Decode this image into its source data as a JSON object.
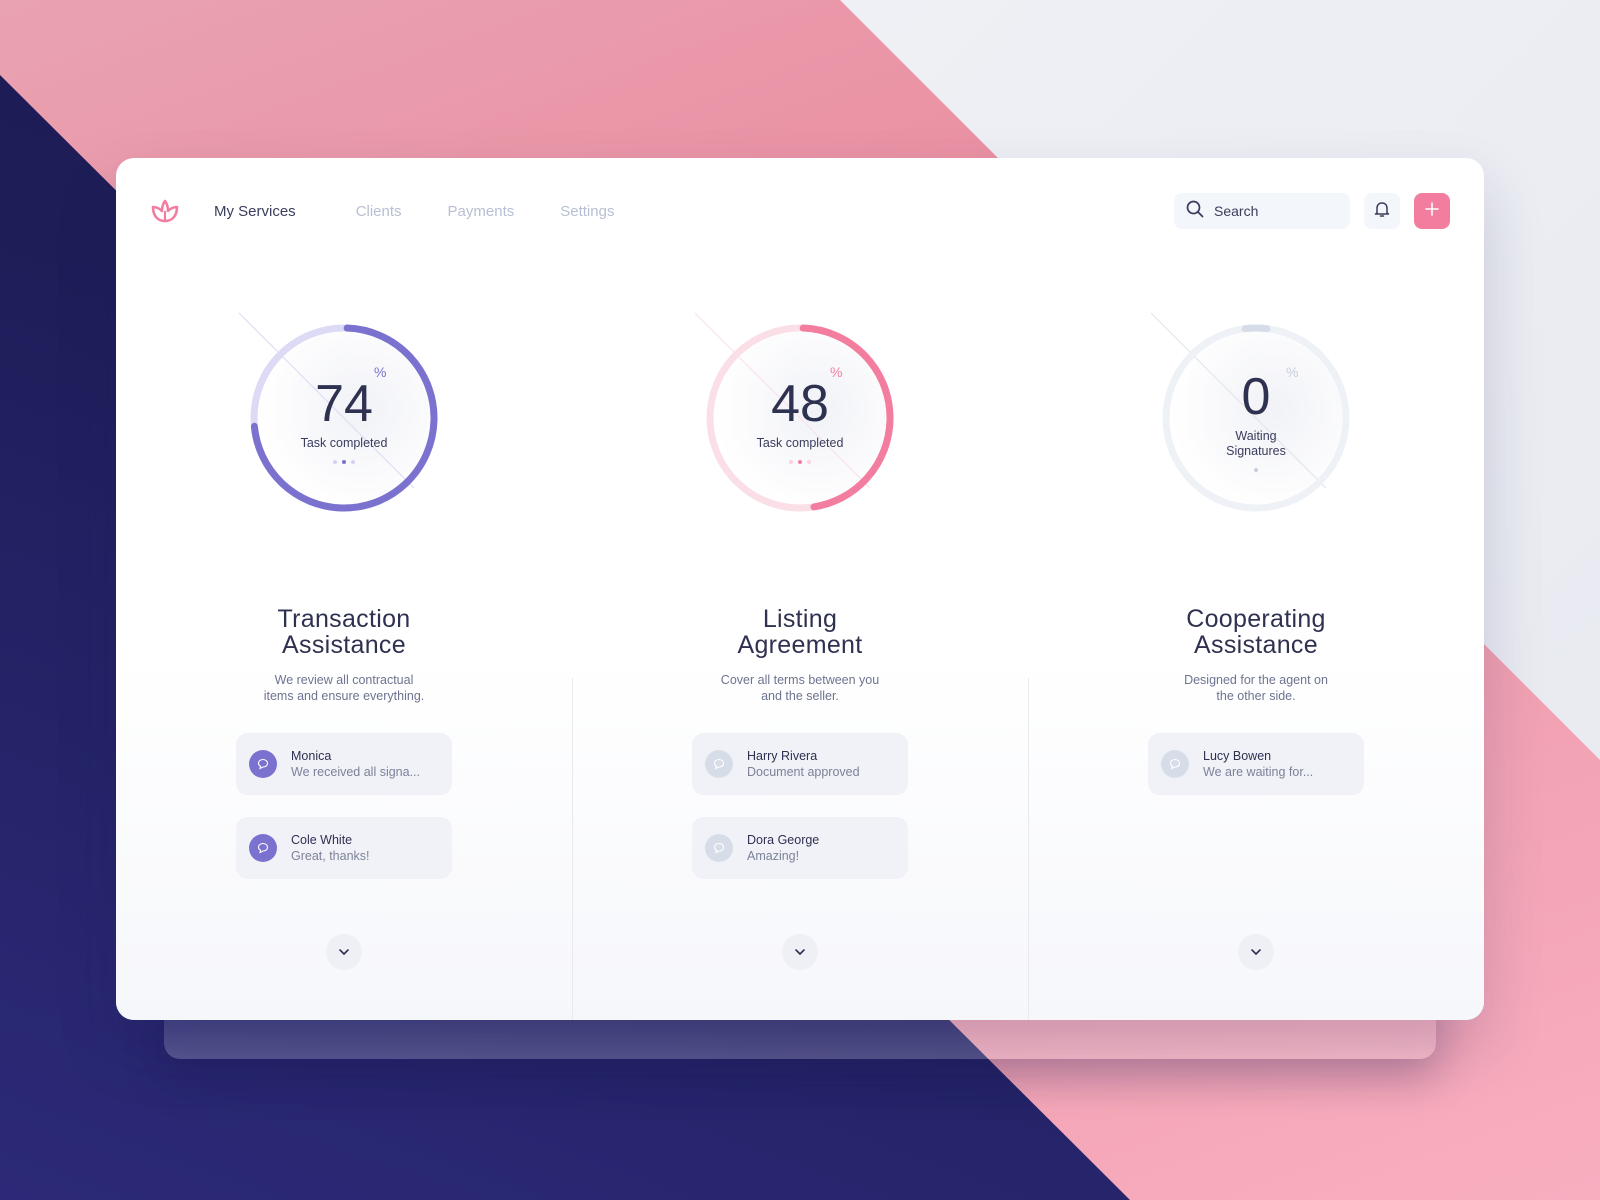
{
  "nav": {
    "logo": "lotus-logo",
    "links": [
      {
        "label": "My Services",
        "active": true
      },
      {
        "label": "Clients",
        "active": false
      },
      {
        "label": "Payments",
        "active": false
      },
      {
        "label": "Settings",
        "active": false
      }
    ],
    "search": {
      "placeholder": "Search",
      "value": ""
    },
    "notifications_icon": "bell-icon",
    "add_icon": "plus-icon"
  },
  "colors": {
    "purple": "#7b72d0",
    "purple_light": "#dcdaf5",
    "pink": "#f27d9f",
    "pink_light": "#fbdfe6",
    "gray": "#d7dde8",
    "gray_light": "#eef1f6",
    "dark_text": "#2f3150"
  },
  "services": [
    {
      "value": "74",
      "unit": "%",
      "progress_percent": 74,
      "label": "Task completed",
      "accent": "purple",
      "title_line1": "Transaction",
      "title_line2": "Assistance",
      "desc_line1": "We review all contractual",
      "desc_line2": "items and ensure everything.",
      "messages": [
        {
          "name": "Monica",
          "preview": "We received all signa..."
        },
        {
          "name": "Cole White",
          "preview": "Great, thanks!"
        }
      ]
    },
    {
      "value": "48",
      "unit": "%",
      "progress_percent": 48,
      "label": "Task completed",
      "accent": "pink",
      "title_line1": "Listing",
      "title_line2": "Agreement",
      "desc_line1": "Cover all terms between you",
      "desc_line2": "and the seller.",
      "messages": [
        {
          "name": "Harry Rivera",
          "preview": "Document approved"
        },
        {
          "name": "Dora George",
          "preview": "Amazing!"
        }
      ]
    },
    {
      "value": "0",
      "unit": "%",
      "progress_percent": 0,
      "label": "Waiting Signatures",
      "accent": "gray",
      "title_line1": "Cooperating",
      "title_line2": "Assistance",
      "desc_line1": "Designed for the agent on",
      "desc_line2": "the other side.",
      "messages": [
        {
          "name": "Lucy Bowen",
          "preview": "We are waiting for..."
        }
      ]
    }
  ]
}
